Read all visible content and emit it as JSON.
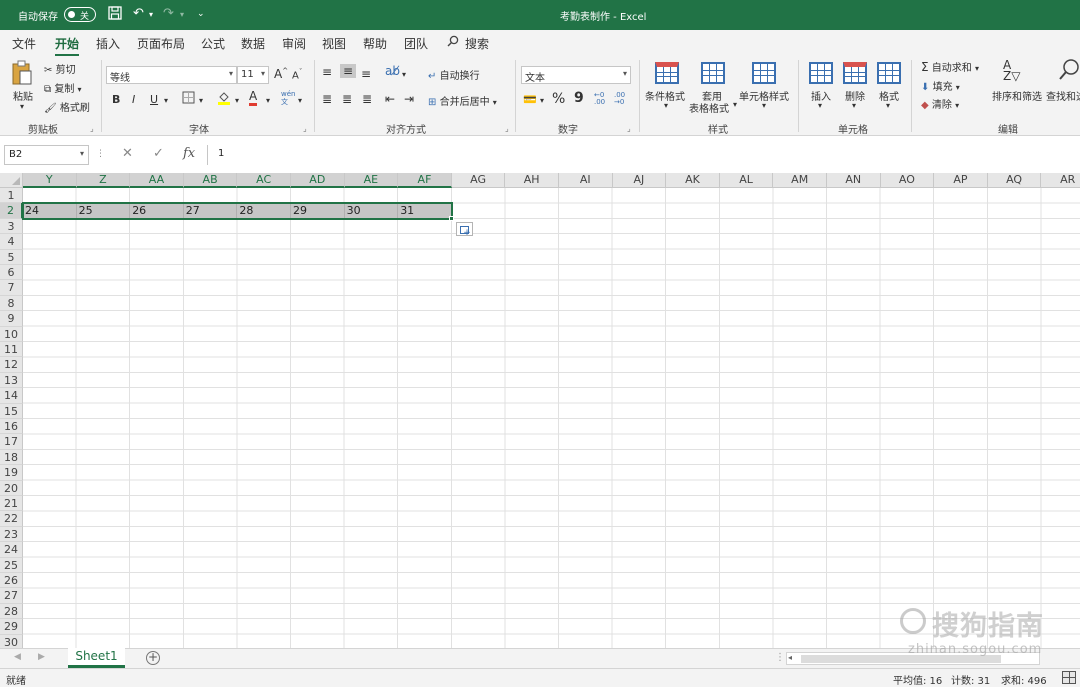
{
  "titlebar": {
    "autosave_label": "自动保存",
    "autosave_state": "关",
    "document_title": "考勤表制作  -  Excel"
  },
  "ribbon_tabs": [
    "文件",
    "开始",
    "插入",
    "页面布局",
    "公式",
    "数据",
    "审阅",
    "视图",
    "帮助",
    "团队",
    "搜索"
  ],
  "active_tab": "开始",
  "ribbon": {
    "clipboard": {
      "paste": "粘贴",
      "cut": "剪切",
      "copy": "复制",
      "format_painter": "格式刷",
      "group_label": "剪贴板"
    },
    "font": {
      "font_name": "等线",
      "font_size": "11",
      "grow": "A",
      "shrink": "A",
      "bold": "B",
      "italic": "I",
      "underline": "U",
      "group_label": "字体"
    },
    "alignment": {
      "wrap_text": "自动换行",
      "merge_center": "合并后居中",
      "group_label": "对齐方式"
    },
    "number": {
      "format": "文本",
      "percent": "%",
      "comma": "9",
      "group_label": "数字"
    },
    "styles": {
      "conditional": "条件格式",
      "format_table_1": "套用",
      "format_table_2": "表格格式",
      "cell_styles": "单元格样式",
      "group_label": "样式"
    },
    "cells": {
      "insert": "插入",
      "delete": "删除",
      "format": "格式",
      "group_label": "单元格"
    },
    "editing": {
      "autosum": "自动求和",
      "fill": "填充",
      "clear": "清除",
      "sort_filter": "排序和筛选",
      "find_select": "查找和选",
      "group_label": "编辑"
    }
  },
  "formula_bar": {
    "name_box": "B2",
    "cancel_icon": "✕",
    "enter_icon": "✓",
    "fx": "fx",
    "value": "1"
  },
  "grid": {
    "columns": [
      "Y",
      "Z",
      "AA",
      "AB",
      "AC",
      "AD",
      "AE",
      "AF",
      "AG",
      "AH",
      "AI",
      "AJ",
      "AK",
      "AL",
      "AM",
      "AN",
      "AO",
      "AP",
      "AQ",
      "AR"
    ],
    "selected_columns": [
      "Y",
      "Z",
      "AA",
      "AB",
      "AC",
      "AD",
      "AE",
      "AF"
    ],
    "rows": [
      "1",
      "2",
      "3",
      "4",
      "5",
      "6",
      "7",
      "8",
      "9",
      "10",
      "11",
      "12",
      "13",
      "14",
      "15",
      "16",
      "17",
      "18",
      "19",
      "20",
      "21",
      "22",
      "23",
      "24",
      "25",
      "26",
      "27",
      "28",
      "29",
      "30"
    ],
    "selected_row": "2",
    "row2_values": [
      "24",
      "25",
      "26",
      "27",
      "28",
      "29",
      "30",
      "31"
    ]
  },
  "sheet_tabs": {
    "active": "Sheet1",
    "add_label": "+"
  },
  "statusbar": {
    "ready": "就绪",
    "average": "平均值: 16",
    "count": "计数: 31",
    "sum": "求和: 496"
  },
  "watermark": {
    "brand": "搜狗指南",
    "domain": "zhinan.sogou.com"
  },
  "colors": {
    "excel_green": "#217346",
    "selection_gray": "#c6c6c6"
  }
}
